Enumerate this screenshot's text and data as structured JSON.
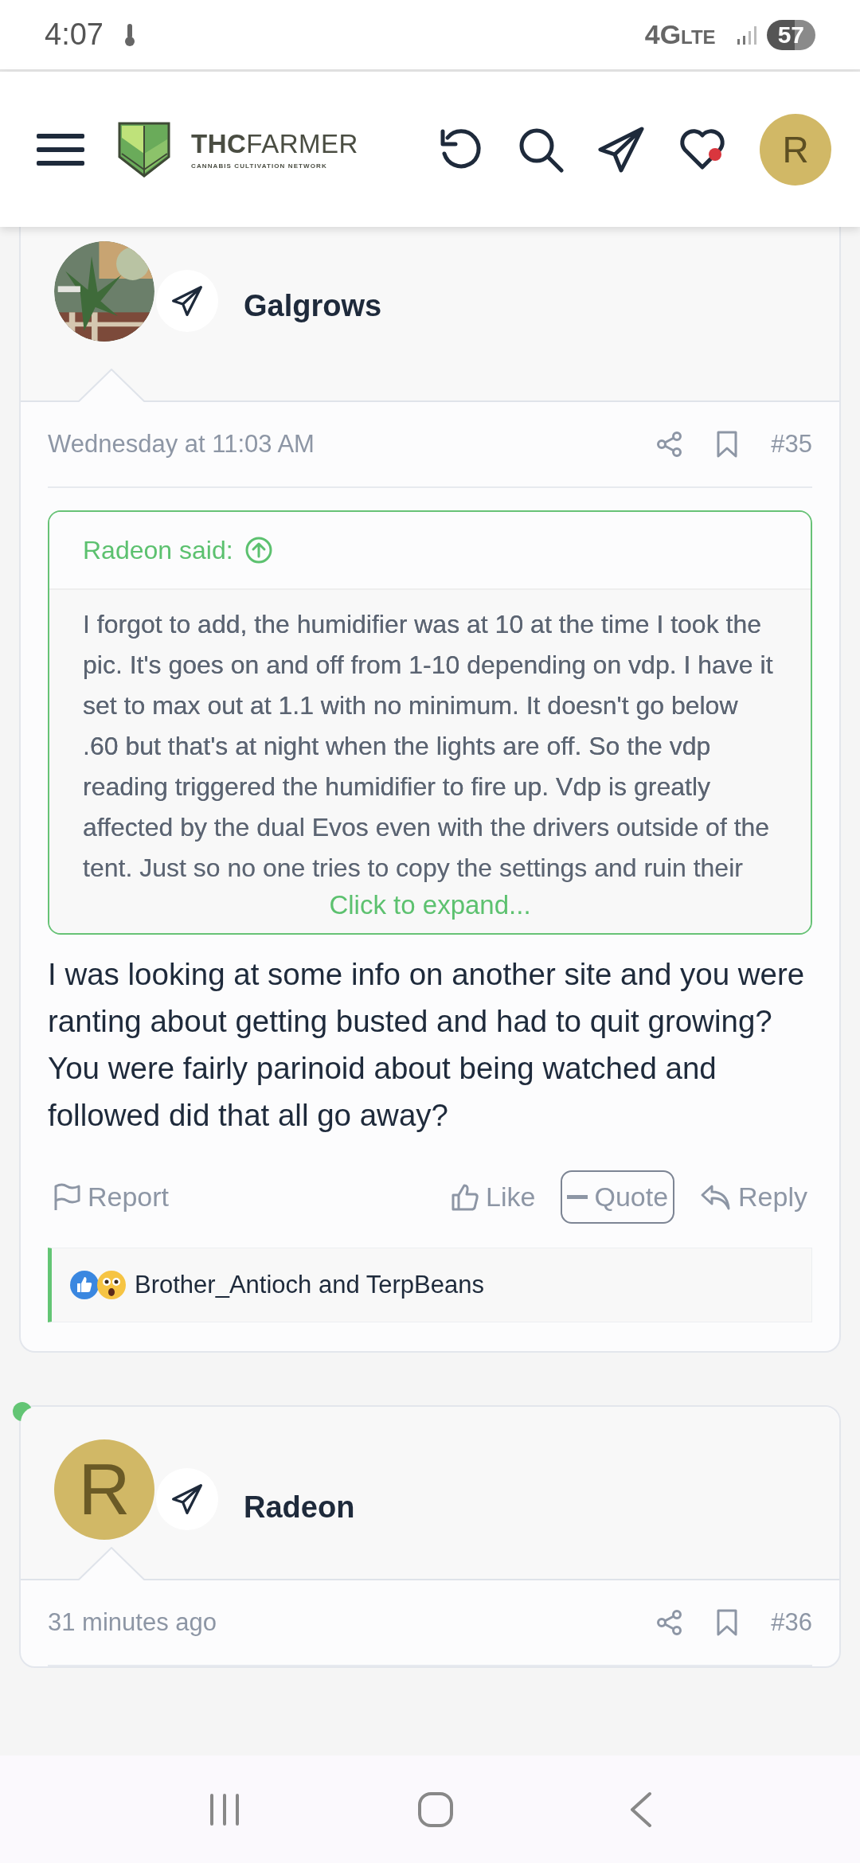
{
  "status_bar": {
    "time": "4:07",
    "network": "4G",
    "network_sub": "LTE",
    "battery": "57"
  },
  "header": {
    "logo_main": "THC",
    "logo_rest": "FARMER",
    "logo_tagline": "CANNABIS CULTIVATION NETWORK",
    "avatar_letter": "R",
    "notification": true
  },
  "posts": [
    {
      "author": "Galgrows",
      "online": false,
      "date": "Wednesday at 11:03 AM",
      "number": "#35",
      "quote": {
        "author": "Radeon said:",
        "text": "I forgot to add, the humidifier was at 10 at the time I took the pic. It's goes on and off from 1-10 depending on vdp. I have it set to max out at 1.1 with no minimum. It doesn't go below .60 but that's at night when the lights are off. So the vdp reading triggered the humidifier to fire up. Vdp is greatly affected by the dual Evos even with the drivers outside of the tent. Just so no one tries to copy the settings and ruin their",
        "expand": "Click to expand..."
      },
      "body": "I was looking at some info on another site and you were ranting about getting busted and had to quit growing? You were fairly parinoid about being watched and followed did that all go away?",
      "actions": [
        {
          "kind": "report",
          "label": "Report",
          "selected": false
        },
        {
          "kind": "like",
          "label": "Like",
          "selected": false
        },
        {
          "kind": "quote",
          "label": "Quote",
          "selected": true
        },
        {
          "kind": "reply",
          "label": "Reply",
          "selected": false
        }
      ],
      "reactions": "Brother_Antioch and TerpBeans"
    },
    {
      "author": "Radeon",
      "avatar_letter": "R",
      "online": true,
      "date": "31 minutes ago",
      "number": "#36"
    }
  ]
}
